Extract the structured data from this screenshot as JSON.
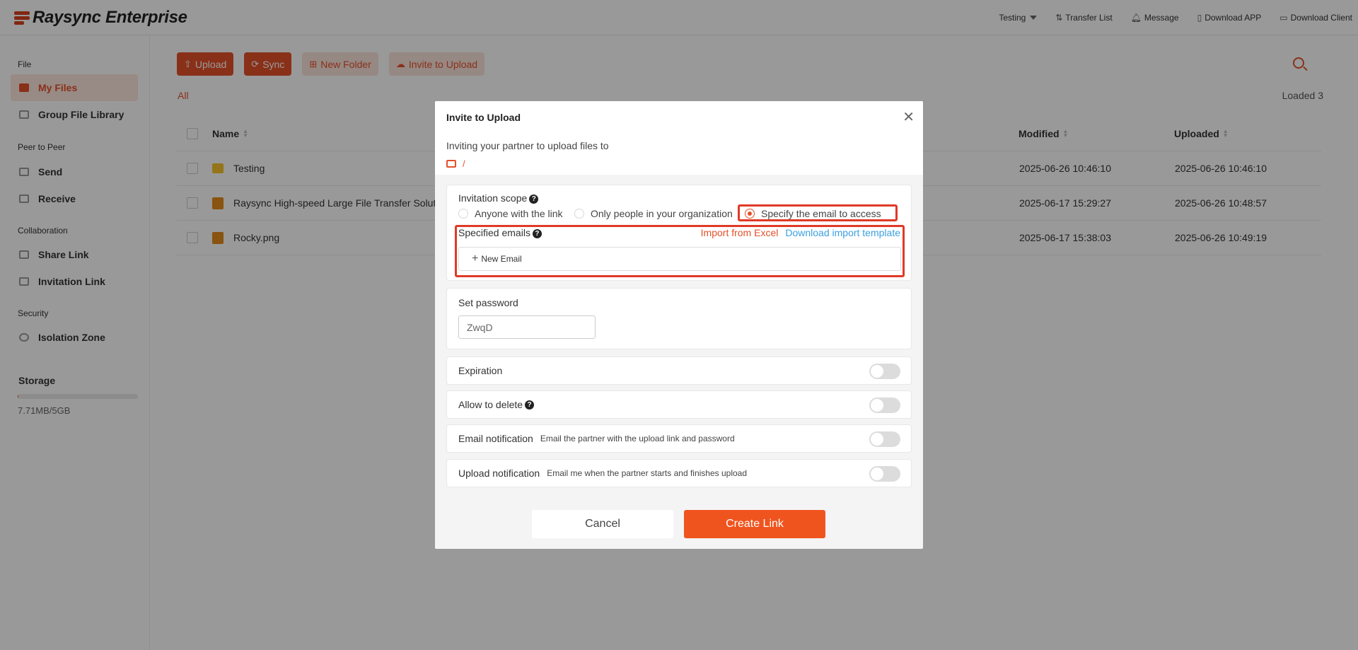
{
  "app": {
    "title": "Raysync Enterprise"
  },
  "header": {
    "user": "Testing",
    "transfer_list": "Transfer List",
    "message": "Message",
    "download_app": "Download APP",
    "download_client": "Download Client"
  },
  "sidebar": {
    "sections": {
      "file": "File",
      "p2p": "Peer to Peer",
      "collab": "Collaboration",
      "security": "Security"
    },
    "items": {
      "my_files": "My Files",
      "group_library": "Group File Library",
      "send": "Send",
      "receive": "Receive",
      "share_link": "Share Link",
      "invitation_link": "Invitation Link",
      "isolation_zone": "Isolation Zone"
    },
    "storage": {
      "title": "Storage",
      "usage": "7.71MB/5GB",
      "used_fraction": 0.0015
    }
  },
  "toolbar": {
    "upload": "Upload",
    "sync": "Sync",
    "new_folder": "New Folder",
    "invite": "Invite to Upload"
  },
  "main": {
    "breadcrumb": "All",
    "loaded": "Loaded 3",
    "columns": {
      "name": "Name",
      "modified": "Modified",
      "uploaded": "Uploaded"
    },
    "rows": [
      {
        "name": "Testing",
        "type": "folder",
        "modified": "2025-06-26 10:46:10",
        "uploaded": "2025-06-26 10:46:10"
      },
      {
        "name": "Raysync High-speed Large File Transfer Solut",
        "type": "doc",
        "modified": "2025-06-17 15:29:27",
        "uploaded": "2025-06-26 10:48:57"
      },
      {
        "name": "Rocky.png",
        "type": "doc",
        "modified": "2025-06-17 15:38:03",
        "uploaded": "2025-06-26 10:49:19"
      }
    ]
  },
  "modal": {
    "title": "Invite to Upload",
    "subtitle": "Inviting your partner to upload files to",
    "path": "/",
    "scope": {
      "label": "Invitation scope",
      "options": [
        "Anyone with the link",
        "Only people in your organization",
        "Specify the email to access"
      ],
      "selected": 2
    },
    "emails": {
      "label": "Specified emails",
      "import_excel": "Import from Excel",
      "download_template": "Download import template",
      "new_email": "New Email"
    },
    "password": {
      "label": "Set password",
      "value": "ZwqD"
    },
    "expiration": {
      "label": "Expiration",
      "on": false
    },
    "allow_delete": {
      "label": "Allow to delete",
      "on": false
    },
    "email_notification": {
      "label": "Email notification",
      "desc": "Email the partner with the upload link and password",
      "on": false
    },
    "upload_notification": {
      "label": "Upload notification",
      "desc": "Email me when the partner starts and finishes upload",
      "on": false
    },
    "cancel": "Cancel",
    "create": "Create Link"
  },
  "colors": {
    "accent": "#e4502a",
    "link_blue": "#3ba0e0",
    "highlight": "#e03a27"
  }
}
